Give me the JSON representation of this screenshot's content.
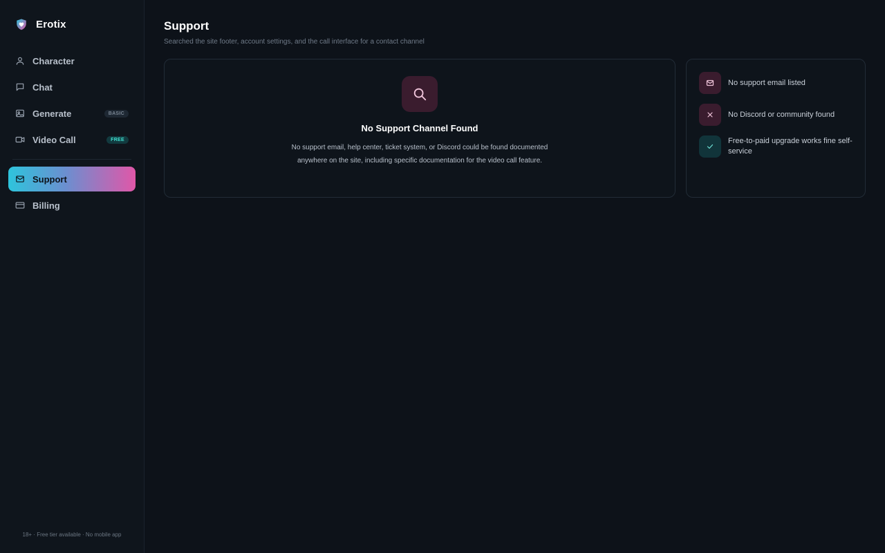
{
  "brand": {
    "name": "Erotix",
    "logo_icon": "heart-shield-icon"
  },
  "sidebar": {
    "items": [
      {
        "label": "Character",
        "icon": "user-icon",
        "active": false
      },
      {
        "label": "Chat",
        "icon": "chat-bubble-icon",
        "active": false
      },
      {
        "label": "Generate",
        "icon": "image-icon",
        "badge": "BASIC",
        "active": false
      },
      {
        "label": "Video Call",
        "icon": "video-camera-icon",
        "badge": "FREE",
        "active": false
      },
      {
        "label": "Support",
        "icon": "mail-icon",
        "active": true
      },
      {
        "label": "Billing",
        "icon": "credit-card-icon",
        "active": false
      }
    ],
    "footer": "18+ · Free tier available · No mobile app"
  },
  "page": {
    "title": "Support",
    "subtitle": "Searched the site footer, account settings, and the call interface for a contact channel"
  },
  "main_card": {
    "icon": "search-icon",
    "title": "No Support Channel Found",
    "text": "No support email, help center, ticket system, or Discord could be found documented anywhere on the site, including specific documentation for the video call feature."
  },
  "status_card": {
    "items": [
      {
        "icon": "mail-icon",
        "text": "No support email listed",
        "tone": "pink"
      },
      {
        "icon": "x-icon",
        "text": "No Discord or community found",
        "tone": "pink"
      },
      {
        "icon": "check-icon",
        "text": "Free-to-paid upgrade works fine self-service",
        "tone": "teal"
      }
    ]
  },
  "colors": {
    "background": "#0d1219",
    "sidebar": "#0f151c",
    "accent_gradient_start": "#2ec4dc",
    "accent_gradient_end": "#e057a8",
    "pink_tile": "#3a1c2e",
    "teal_tile": "#11343a",
    "free_badge": "#3fe0d0"
  }
}
